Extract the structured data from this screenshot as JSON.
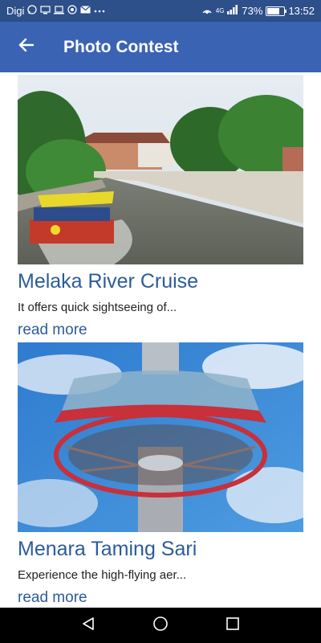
{
  "status_bar": {
    "carrier": "Digi",
    "battery": "73%",
    "battery_level": 0.73,
    "time": "13:52",
    "left_icons": [
      "whatsapp-icon",
      "desktop-icon",
      "laptop-icon",
      "hotspot-icon",
      "mail-icon",
      "more-icon"
    ],
    "right_icons": [
      "hotspot-icon",
      "signal-icon",
      "battery-icon"
    ],
    "signal_label": "4G"
  },
  "app_bar": {
    "title": "Photo Contest",
    "back_icon": "arrow-left-icon",
    "color": "#3a63b4"
  },
  "cards": [
    {
      "title": "Melaka River Cruise",
      "description": "It offers quick sightseeing of...",
      "link": "read more"
    },
    {
      "title": "Menara Taming Sari",
      "description": "Experience the high-flying aer...",
      "link": "read more"
    }
  ],
  "nav_bar": {
    "buttons": [
      "back-triangle-icon",
      "home-circle-icon",
      "recents-square-icon"
    ]
  },
  "colors": {
    "status_bar": "#2d4f8a",
    "accent_text": "#2b5c9b"
  }
}
